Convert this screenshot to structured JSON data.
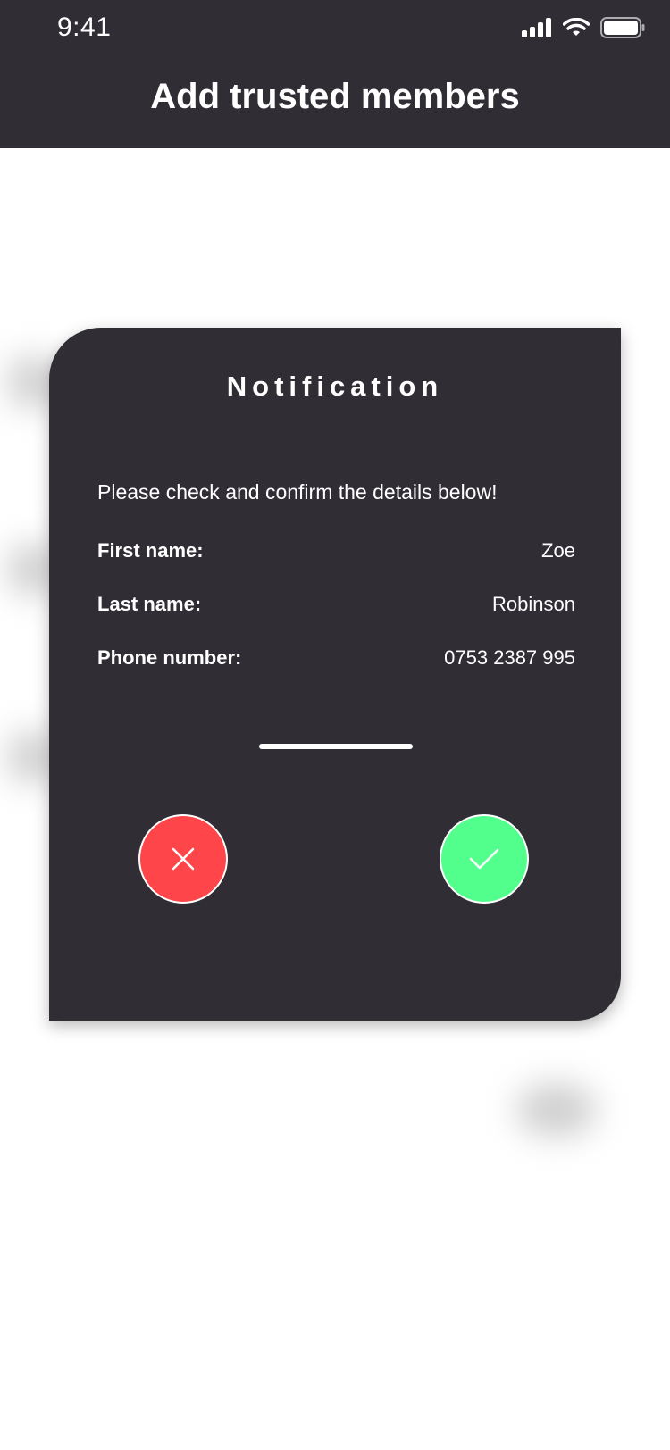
{
  "status_bar": {
    "time": "9:41",
    "icons": [
      "signal-icon",
      "wifi-icon",
      "battery-icon"
    ]
  },
  "header": {
    "title": "Add trusted members"
  },
  "dialog": {
    "title": "Notification",
    "message": "Please check and confirm the details below!",
    "fields": [
      {
        "label": "First name:",
        "value": "Zoe"
      },
      {
        "label": "Last name:",
        "value": "Robinson"
      },
      {
        "label": "Phone number:",
        "value": "0753 2387 995"
      }
    ],
    "cancel_icon": "close-icon",
    "confirm_icon": "checkmark-icon"
  },
  "colors": {
    "dark": "#302d35",
    "cancel": "#fe4549",
    "confirm": "#52ff8c",
    "text": "#ffffff"
  }
}
